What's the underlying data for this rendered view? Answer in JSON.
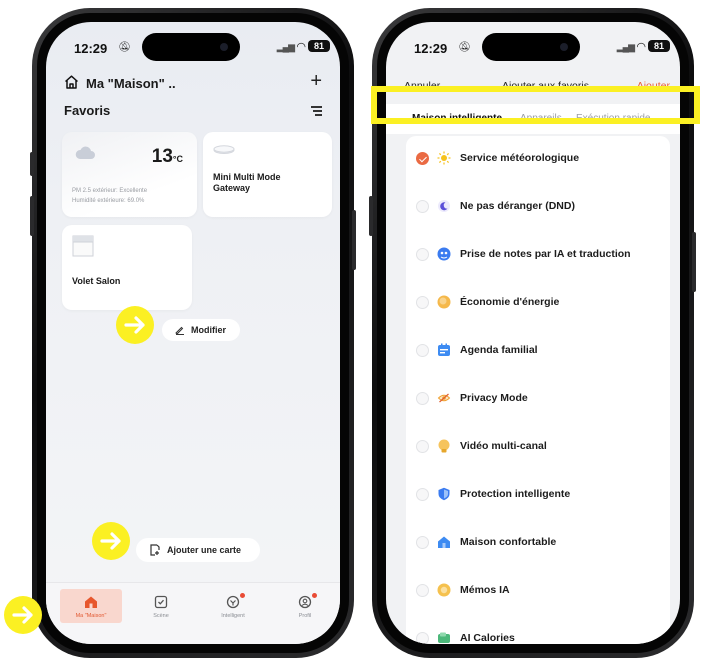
{
  "status_bar": {
    "time": "12:29",
    "battery": "81"
  },
  "home_screen": {
    "home_name": "Ma \"Maison\" ..",
    "favorites_title": "Favoris",
    "weather_card": {
      "temperature": "13",
      "unit": "°C",
      "pm25": "PM 2.5 extérieur: Excellente",
      "humidity": "Humidité extérieure: 69.0%"
    },
    "gateway_card": {
      "name": "Mini Multi Mode Gateway"
    },
    "shutter_card": {
      "name": "Volet Salon"
    },
    "edit_label": "Modifier",
    "add_card_label": "Ajouter une carte",
    "tabs": [
      {
        "label": "Ma \"Maison\"",
        "icon": "home-icon",
        "active": true
      },
      {
        "label": "Scène",
        "icon": "scene-icon",
        "active": false
      },
      {
        "label": "Intelligent",
        "icon": "smart-icon",
        "active": false
      },
      {
        "label": "Profil",
        "icon": "profile-icon",
        "active": false
      }
    ]
  },
  "favorites_screen": {
    "cancel_label": "Annuler",
    "title": "Ajouter aux favoris",
    "add_label": "Ajouter",
    "segments": [
      {
        "label": "Maison intelligente",
        "active": true
      },
      {
        "label": "Appareils",
        "active": false
      },
      {
        "label": "Exécution rapide",
        "active": false
      }
    ],
    "services": [
      {
        "name": "Service météorologique",
        "selected": true,
        "icon": "sun-icon"
      },
      {
        "name": "Ne pas déranger (DND)",
        "selected": false,
        "icon": "moon-icon"
      },
      {
        "name": "Prise de notes par IA et traduction",
        "selected": false,
        "icon": "ai-notes-icon"
      },
      {
        "name": "Économie d'énergie",
        "selected": false,
        "icon": "energy-icon"
      },
      {
        "name": "Agenda familial",
        "selected": false,
        "icon": "calendar-icon"
      },
      {
        "name": "Privacy Mode",
        "selected": false,
        "icon": "eye-off-icon"
      },
      {
        "name": "Vidéo multi-canal",
        "selected": false,
        "icon": "video-icon"
      },
      {
        "name": "Protection intelligente",
        "selected": false,
        "icon": "shield-icon"
      },
      {
        "name": "Maison confortable",
        "selected": false,
        "icon": "comfort-home-icon"
      },
      {
        "name": "Mémos IA",
        "selected": false,
        "icon": "memo-icon"
      },
      {
        "name": "AI Calories",
        "selected": false,
        "icon": "calories-icon"
      }
    ]
  },
  "colors": {
    "accent": "#e8623d",
    "highlight": "#fbf023",
    "active_tab_bg": "#f9d7ce"
  }
}
